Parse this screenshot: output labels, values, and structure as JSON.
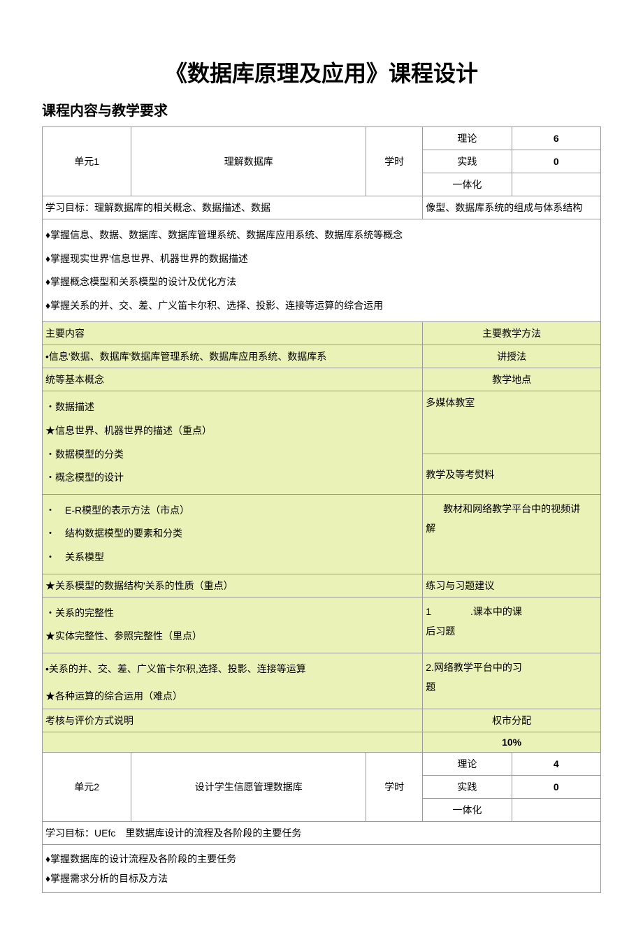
{
  "title": "《数据库原理及应用》课程设计",
  "subtitle": "课程内容与教学要求",
  "unit1": {
    "label": "单元1",
    "name": "理解数据库",
    "hours_label": "学时",
    "theory_label": "理论",
    "theory_val": "6",
    "practice_label": "实践",
    "practice_val": "0",
    "integrated_label": "一体化",
    "integrated_val": "",
    "goal_left": "学习目标：理解数据库的相关概念、数据描述、数据",
    "goal_right": "像型、数据库系统的组成与体系结构",
    "obj1": "♦掌握信息、数据、数据库、数据库管理系统、数据库应用系统、数据库系统等概念",
    "obj2": "♦掌握现实世界'信息世界、机器世界的数据描述",
    "obj3": "♦掌握概念模型和关系模型的设计及优化方法",
    "obj4": "♦掌握关系的并、交、差、广义笛卡尔积、选择、投影、连接等运算的综合运用",
    "main_content_label": "主要内容",
    "main_method_label": "主要教学方法",
    "content_block1_a": "•信息'数据、数据库'数据库管理系统、数据库应用系统、数据库系",
    "content_block1_b": "统等基本概念",
    "method_lecture": "讲授法",
    "place_label": "教学地点",
    "content_block2_a": "・数据描述",
    "content_block2_b": "★信息世界、机器世界的描述（重点）",
    "content_block2_c": "・数据模型的分类",
    "content_block2_d": "・概念模型的设计",
    "place_val": "多媒体教室",
    "content_block3_a": "・　E-R模型的表示方法（市点）",
    "content_block3_b": "・　结构数据模型的要素和分类",
    "content_block3_c": "・　关系模型",
    "materials_label": "教学及等考熨料",
    "materials_val_a": "教材和网络教学平台中的视频讲",
    "materials_val_b": "解",
    "content_block4": "★关系模型的数据结构'关系的性质（重点）",
    "exercise_label": "练习与习题建议",
    "content_block5_a": "・关系的完整性",
    "content_block5_b": "★实体完整性、参照完整性（里点）",
    "exercise1_a": "1　　　　.课本中的课",
    "exercise1_b": "后习题",
    "content_block6_a": "•关系的并、交、差、广义笛卡尔积,选择、投影、连接等运算",
    "content_block6_b": "★各种运算的综合运用（难点）",
    "exercise2_a": "2.网络教学平台中的习",
    "exercise2_b": "题",
    "assess_label": "考核与评价方式说明",
    "weight_label": "权市分配",
    "weight_val": "10%"
  },
  "unit2": {
    "label": "单元2",
    "name": "设计学生信愿管理数据库",
    "hours_label": "学时",
    "theory_label": "理论",
    "theory_val": "4",
    "practice_label": "实践",
    "practice_val": "0",
    "integrated_label": "一体化",
    "integrated_val": "",
    "goal": "学习目标：UEfc　里数据库设计的流程及各阶段的主要任务",
    "obj1": "♦掌握数据库的设计流程及各阶段的主要任务",
    "obj2": "♦掌握需求分析的目标及方法"
  }
}
